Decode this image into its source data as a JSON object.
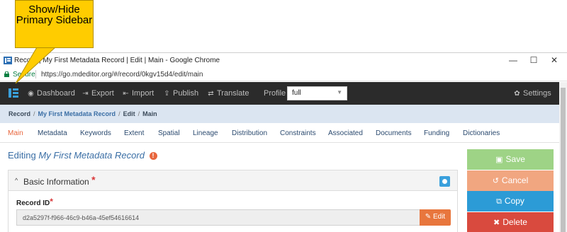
{
  "callout": {
    "text": "Show/Hide Primary Sidebar"
  },
  "window": {
    "title": "Record | My First Metadata Record | Edit | Main - Google Chrome",
    "minimize": "—",
    "maximize": "☐",
    "close": "✕"
  },
  "address": {
    "secure": "Secure",
    "url": "https://go.mdeditor.org/#/record/0kgv15d4/edit/main"
  },
  "nav": {
    "items": [
      {
        "label": "Dashboard",
        "icon": "dashboard-icon",
        "glyph": "◉"
      },
      {
        "label": "Export",
        "icon": "export-icon",
        "glyph": "⇥"
      },
      {
        "label": "Import",
        "icon": "import-icon",
        "glyph": "⇤"
      },
      {
        "label": "Publish",
        "icon": "publish-icon",
        "glyph": "⇪"
      },
      {
        "label": "Translate",
        "icon": "translate-icon",
        "glyph": "⇄"
      }
    ],
    "profile_label": "Profile",
    "profile_value": "full",
    "settings_label": "Settings",
    "settings_glyph": "✿"
  },
  "breadcrumb": {
    "root": "Record",
    "record": "My First Metadata Record",
    "edit": "Edit",
    "current": "Main"
  },
  "tabs": [
    "Main",
    "Metadata",
    "Keywords",
    "Extent",
    "Spatial",
    "Lineage",
    "Distribution",
    "Constraints",
    "Associated",
    "Documents",
    "Funding",
    "Dictionaries"
  ],
  "main": {
    "editing_prefix": "Editing",
    "record_title": "My First Metadata Record",
    "warn_glyph": "!"
  },
  "panel": {
    "title": "Basic Information",
    "required_mark": "*",
    "record_id_label": "Record ID",
    "record_id_value": "d2a5297f-f966-46c9-b46a-45ef54616614",
    "edit_label": "Edit"
  },
  "actions": {
    "save": "Save",
    "cancel": "Cancel",
    "copy": "Copy",
    "delete": "Delete"
  },
  "colors": {
    "accent": "#e8663d",
    "nav_bg": "#2b2b2b",
    "breadcrumb_bg": "#dbe5f1",
    "save": "#9ed386",
    "cancel": "#f1a680",
    "copy": "#2c9bd6",
    "delete": "#d94a3e",
    "callout": "#ffcc00"
  }
}
